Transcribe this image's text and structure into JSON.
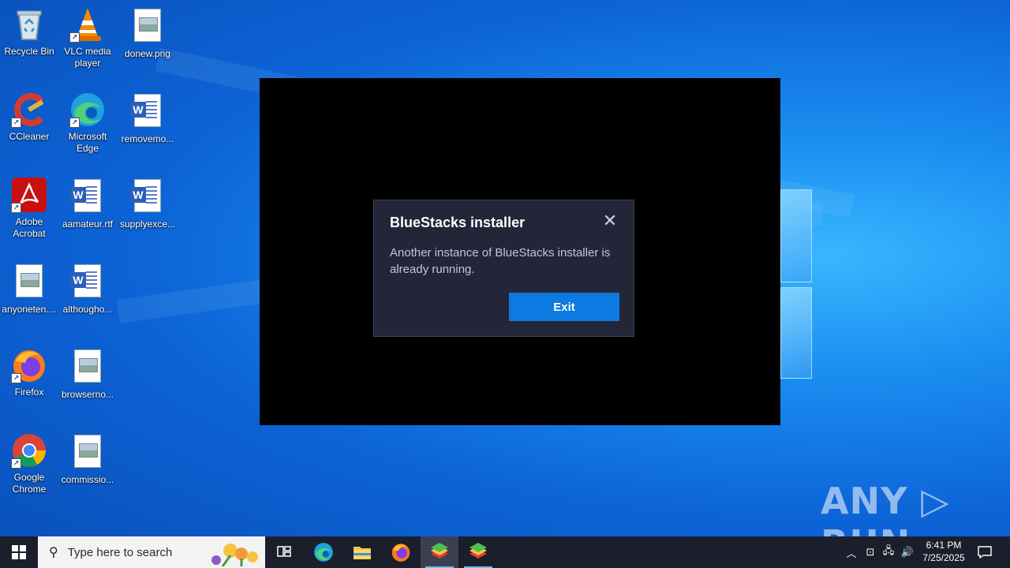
{
  "desktop": {
    "icons": [
      {
        "label": "Recycle Bin"
      },
      {
        "label": "VLC media player"
      },
      {
        "label": "donew.png"
      },
      {
        "label": "CCleaner"
      },
      {
        "label": "Microsoft Edge"
      },
      {
        "label": "removemo..."
      },
      {
        "label": "Adobe Acrobat"
      },
      {
        "label": "aamateur.rtf"
      },
      {
        "label": "supplyexce..."
      },
      {
        "label": "anyoneten...."
      },
      {
        "label": "althougho..."
      },
      {
        "label": "Firefox"
      },
      {
        "label": "browserno..."
      },
      {
        "label": "Google Chrome"
      },
      {
        "label": "commissio..."
      }
    ]
  },
  "dialog": {
    "title": "BlueStacks installer",
    "message": "Another instance of BlueStacks installer is already running.",
    "exit_label": "Exit"
  },
  "watermark": {
    "text": "ANY ▷ RUN"
  },
  "taskbar": {
    "search_placeholder": "Type here to search",
    "clock_time": "6:41 PM",
    "clock_date": "7/25/2025"
  },
  "colors": {
    "accent": "#0c7ae0",
    "dialog_bg": "#232539",
    "taskbar_bg": "#1a1f2b"
  }
}
